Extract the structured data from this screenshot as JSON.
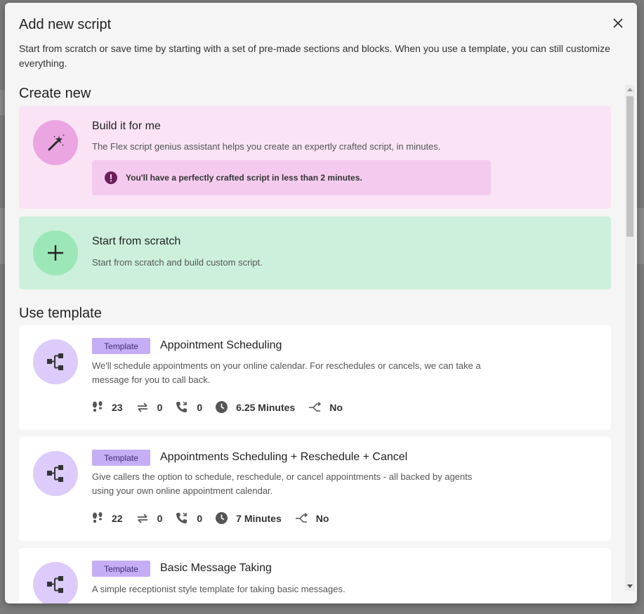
{
  "modal": {
    "title": "Add new script",
    "description": "Start from scratch or save time by starting with a set of pre-made sections and blocks. When you use a template, you can still customize everything."
  },
  "create_new": {
    "heading": "Create new",
    "build": {
      "title": "Build it for me",
      "subtitle": "The Flex script genius assistant helps you create an expertly crafted script, in minutes.",
      "notice": "You'll have a perfectly crafted script in less than 2 minutes."
    },
    "scratch": {
      "title": "Start from scratch",
      "subtitle": "Start from scratch and build custom script."
    }
  },
  "use_template": {
    "heading": "Use template",
    "badge_label": "Template",
    "templates": [
      {
        "title": "Appointment Scheduling",
        "description": "We'll schedule appointments on your online calendar. For reschedules or cancels, we can take a message for you to call back.",
        "steps": "23",
        "transfers": "0",
        "calls": "0",
        "duration": "6.25 Minutes",
        "branching": "No"
      },
      {
        "title": "Appointments Scheduling + Reschedule + Cancel",
        "description": "Give callers the option to schedule, reschedule, or cancel appointments - all backed by agents using your own online appointment calendar.",
        "steps": "22",
        "transfers": "0",
        "calls": "0",
        "duration": "7 Minutes",
        "branching": "No"
      },
      {
        "title": "Basic Message Taking",
        "description": "A simple receptionist style template for taking basic messages."
      }
    ]
  },
  "colors": {
    "build_card": "#f9e3f5",
    "scratch_card": "#cdf0dc",
    "badge": "#c5aef5",
    "template_icon_bg": "#dccbfb"
  }
}
